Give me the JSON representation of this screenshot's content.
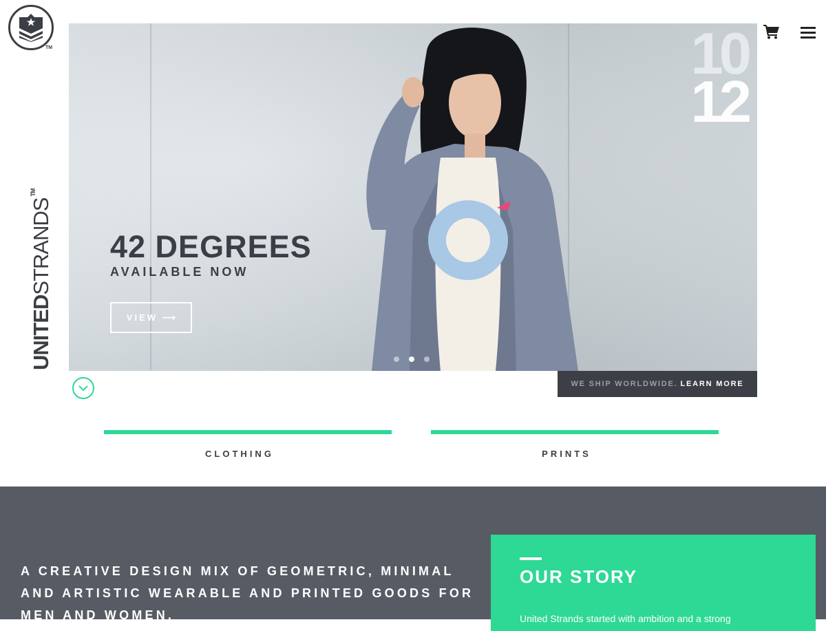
{
  "brand": {
    "logo_tm": "TM",
    "name_bold": "UNITED",
    "name_light": "STRANDS",
    "tm": "TM"
  },
  "header": {
    "cart_icon": "shopping-cart-icon",
    "menu_icon": "hamburger-menu-icon"
  },
  "hero": {
    "title": "42 DEGREES",
    "subtitle": "AVAILABLE NOW",
    "view_label": "VIEW",
    "view_arrow": "⟶",
    "big_number_top": "10",
    "big_number_bottom": "12",
    "slides": 3,
    "active_slide": 2
  },
  "shipping": {
    "text": "WE SHIP WORLDWIDE.",
    "link": "LEARN MORE"
  },
  "categories": [
    {
      "label": "CLOTHING"
    },
    {
      "label": "PRINTS"
    }
  ],
  "about": {
    "tagline": "A CREATIVE DESIGN MIX OF GEOMETRIC, MINIMAL AND ARTISTIC WEARABLE AND PRINTED GOODS FOR MEN AND WOMEN.",
    "story_title": "OUR STORY",
    "story_text": "United Strands started with ambition and a strong"
  },
  "colors": {
    "accent": "#2ed895",
    "dark": "#3b3e44",
    "bottom_bg": "#575b64"
  }
}
